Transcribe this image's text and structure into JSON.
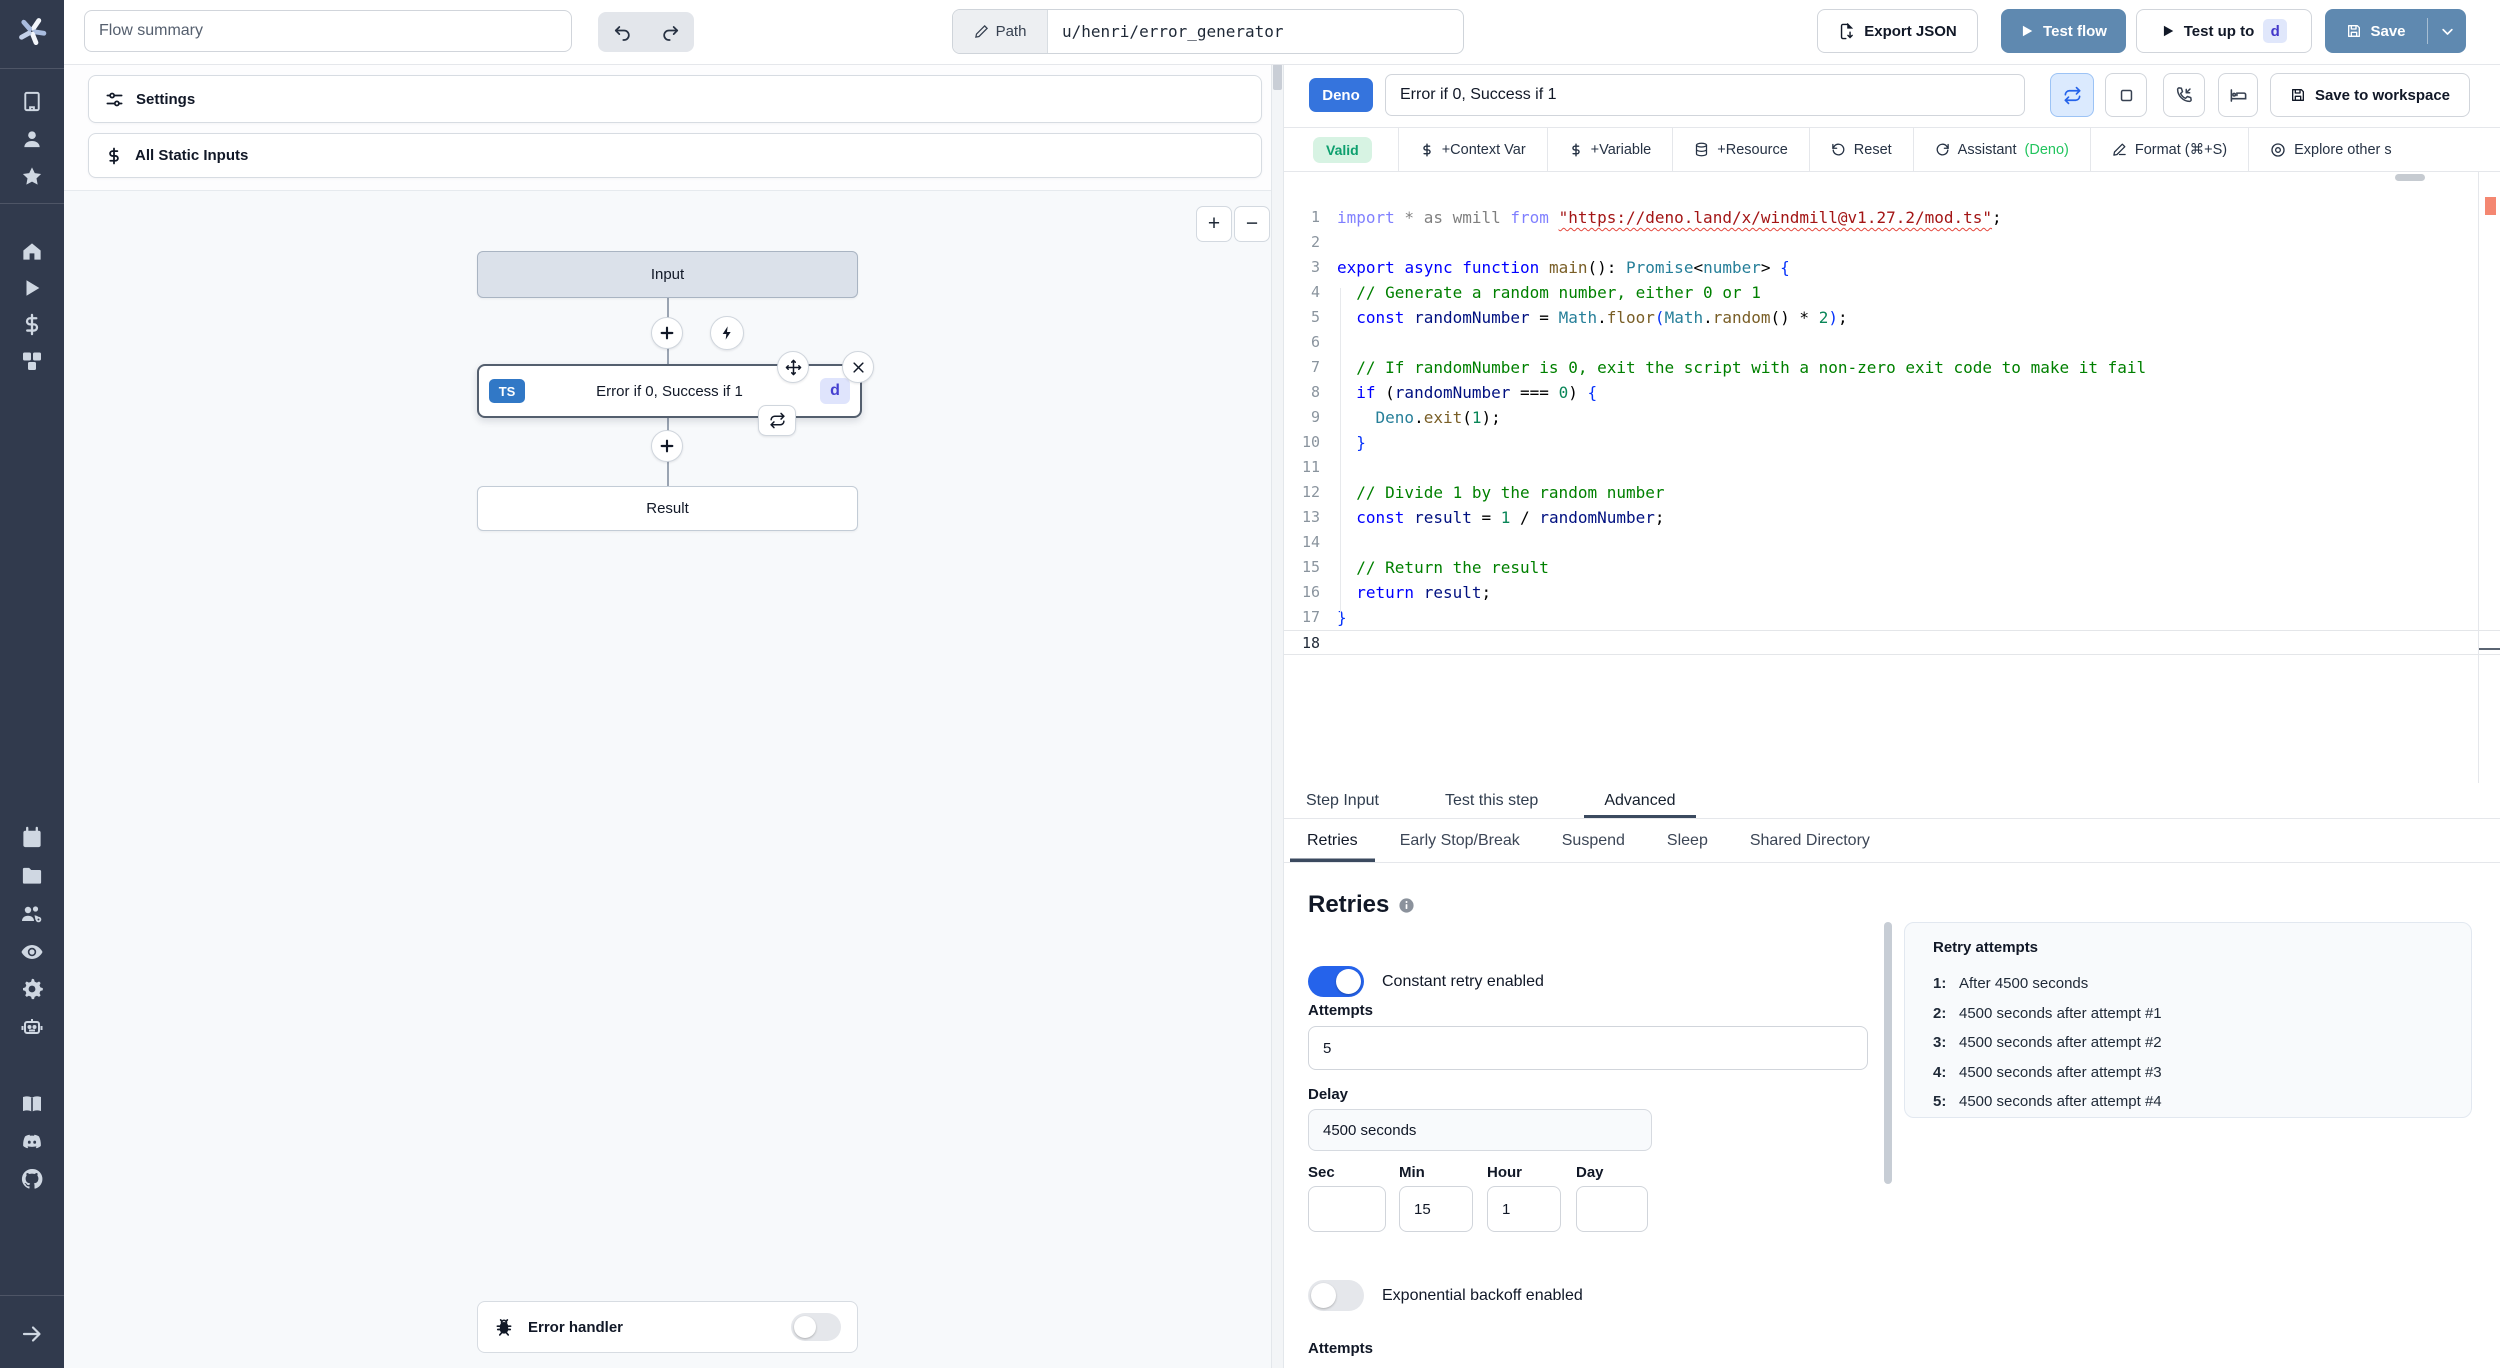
{
  "topbar": {
    "flow_summary_placeholder": "Flow summary",
    "path_label": "Path",
    "path_value": "u/henri/error_generator",
    "export_json_label": "Export JSON",
    "test_flow_label": "Test flow",
    "test_up_to_label": "Test up to",
    "test_up_to_badge": "d",
    "save_label": "Save"
  },
  "flow_panel": {
    "settings_label": "Settings",
    "static_inputs_label": "All Static Inputs",
    "zoom_in": "+",
    "zoom_out": "−",
    "graph": {
      "input_label": "Input",
      "step_lang_badge": "TS",
      "step_label": "Error if 0, Success if 1",
      "step_suffix_badge": "d",
      "result_label": "Result",
      "error_handler_label": "Error handler"
    }
  },
  "editor_header": {
    "lang_badge": "Deno",
    "step_name": "Error if 0, Success if 1",
    "save_to_workspace_label": "Save to workspace"
  },
  "toolbar": {
    "valid_label": "Valid",
    "context_var_label": "+Context Var",
    "variable_label": "+Variable",
    "resource_label": "+Resource",
    "reset_label": "Reset",
    "assistant_label": "Assistant",
    "assistant_lang": "(Deno)",
    "format_label": "Format (⌘+S)",
    "explore_label": "Explore other s"
  },
  "code": {
    "current_line": 18,
    "lines": [
      [
        {
          "t": "import",
          "c": "kw fade"
        },
        {
          "t": " * as wmill ",
          "c": "fade"
        },
        {
          "t": "from",
          "c": "kw fade"
        },
        {
          "t": " ",
          "c": ""
        },
        {
          "t": "\"https://deno.land/x/windmill@v1.27.2/mod.ts\"",
          "c": "str squiggle"
        },
        {
          "t": ";",
          "c": ""
        }
      ],
      [],
      [
        {
          "t": "export",
          "c": "kw"
        },
        {
          "t": " ",
          "c": ""
        },
        {
          "t": "async",
          "c": "kw"
        },
        {
          "t": " ",
          "c": ""
        },
        {
          "t": "function",
          "c": "kw"
        },
        {
          "t": " ",
          "c": ""
        },
        {
          "t": "main",
          "c": "fn"
        },
        {
          "t": "(): ",
          "c": ""
        },
        {
          "t": "Promise",
          "c": "type"
        },
        {
          "t": "<",
          "c": ""
        },
        {
          "t": "number",
          "c": "type"
        },
        {
          "t": "> ",
          "c": ""
        },
        {
          "t": "{",
          "c": "brace"
        }
      ],
      [
        {
          "t": "  // Generate a random number, either 0 or 1",
          "c": "cmt"
        }
      ],
      [
        {
          "t": "  ",
          "c": ""
        },
        {
          "t": "const",
          "c": "kw"
        },
        {
          "t": " ",
          "c": ""
        },
        {
          "t": "randomNumber",
          "c": "var"
        },
        {
          "t": " = ",
          "c": ""
        },
        {
          "t": "Math",
          "c": "type"
        },
        {
          "t": ".",
          "c": ""
        },
        {
          "t": "floor",
          "c": "fn"
        },
        {
          "t": "(",
          "c": "brace"
        },
        {
          "t": "Math",
          "c": "type"
        },
        {
          "t": ".",
          "c": ""
        },
        {
          "t": "random",
          "c": "fn"
        },
        {
          "t": "() * ",
          "c": ""
        },
        {
          "t": "2",
          "c": "num"
        },
        {
          "t": ")",
          "c": "brace"
        },
        {
          "t": ";",
          "c": ""
        }
      ],
      [],
      [
        {
          "t": "  // If randomNumber is 0, exit the script with a non-zero exit code to make it fail",
          "c": "cmt"
        }
      ],
      [
        {
          "t": "  ",
          "c": ""
        },
        {
          "t": "if",
          "c": "kw"
        },
        {
          "t": " (",
          "c": ""
        },
        {
          "t": "randomNumber",
          "c": "var"
        },
        {
          "t": " === ",
          "c": ""
        },
        {
          "t": "0",
          "c": "num"
        },
        {
          "t": ") ",
          "c": ""
        },
        {
          "t": "{",
          "c": "brace"
        }
      ],
      [
        {
          "t": "    ",
          "c": ""
        },
        {
          "t": "Deno",
          "c": "type"
        },
        {
          "t": ".",
          "c": ""
        },
        {
          "t": "exit",
          "c": "fn"
        },
        {
          "t": "(",
          "c": ""
        },
        {
          "t": "1",
          "c": "num"
        },
        {
          "t": ");",
          "c": ""
        }
      ],
      [
        {
          "t": "  }",
          "c": "brace"
        }
      ],
      [],
      [
        {
          "t": "  // Divide 1 by the random number",
          "c": "cmt"
        }
      ],
      [
        {
          "t": "  ",
          "c": ""
        },
        {
          "t": "const",
          "c": "kw"
        },
        {
          "t": " ",
          "c": ""
        },
        {
          "t": "result",
          "c": "var"
        },
        {
          "t": " = ",
          "c": ""
        },
        {
          "t": "1",
          "c": "num"
        },
        {
          "t": " / ",
          "c": ""
        },
        {
          "t": "randomNumber",
          "c": "var"
        },
        {
          "t": ";",
          "c": ""
        }
      ],
      [],
      [
        {
          "t": "  // Return the result",
          "c": "cmt"
        }
      ],
      [
        {
          "t": "  ",
          "c": ""
        },
        {
          "t": "return",
          "c": "kw"
        },
        {
          "t": " ",
          "c": ""
        },
        {
          "t": "result",
          "c": "var"
        },
        {
          "t": ";",
          "c": ""
        }
      ],
      [
        {
          "t": "}",
          "c": "brace"
        }
      ],
      []
    ]
  },
  "tabs": {
    "items": [
      "Step Input",
      "Test this step",
      "Advanced"
    ],
    "active": "Advanced"
  },
  "subtabs": {
    "items": [
      "Retries",
      "Early Stop/Break",
      "Suspend",
      "Sleep",
      "Shared Directory"
    ],
    "active": "Retries"
  },
  "retries": {
    "title": "Retries",
    "constant_toggle_label": "Constant retry enabled",
    "constant_toggle_on": true,
    "attempts_label": "Attempts",
    "attempts_value": "5",
    "delay_label": "Delay",
    "delay_value": "4500 seconds",
    "time_fields": [
      {
        "label": "Sec",
        "value": ""
      },
      {
        "label": "Min",
        "value": "15"
      },
      {
        "label": "Hour",
        "value": "1"
      },
      {
        "label": "Day",
        "value": ""
      }
    ],
    "exponential_toggle_label": "Exponential backoff enabled",
    "exponential_toggle_on": false,
    "clipped_label": "Attempts",
    "summary": {
      "title": "Retry attempts",
      "items": [
        {
          "n": "1:",
          "text": "After 4500 seconds"
        },
        {
          "n": "2:",
          "text": "4500 seconds after attempt #1"
        },
        {
          "n": "3:",
          "text": "4500 seconds after attempt #2"
        },
        {
          "n": "4:",
          "text": "4500 seconds after attempt #3"
        },
        {
          "n": "5:",
          "text": "4500 seconds after attempt #4"
        }
      ]
    }
  },
  "colors": {
    "accent_blue": "#5f89b0",
    "toggle_blue": "#2563eb",
    "deno_badge_blue": "#3574dd",
    "ts_badge_blue": "#3178c6",
    "valid_green_bg": "#d7f3e3",
    "valid_green_text": "#0d9f6e",
    "sidebar_bg": "#313a4d"
  }
}
